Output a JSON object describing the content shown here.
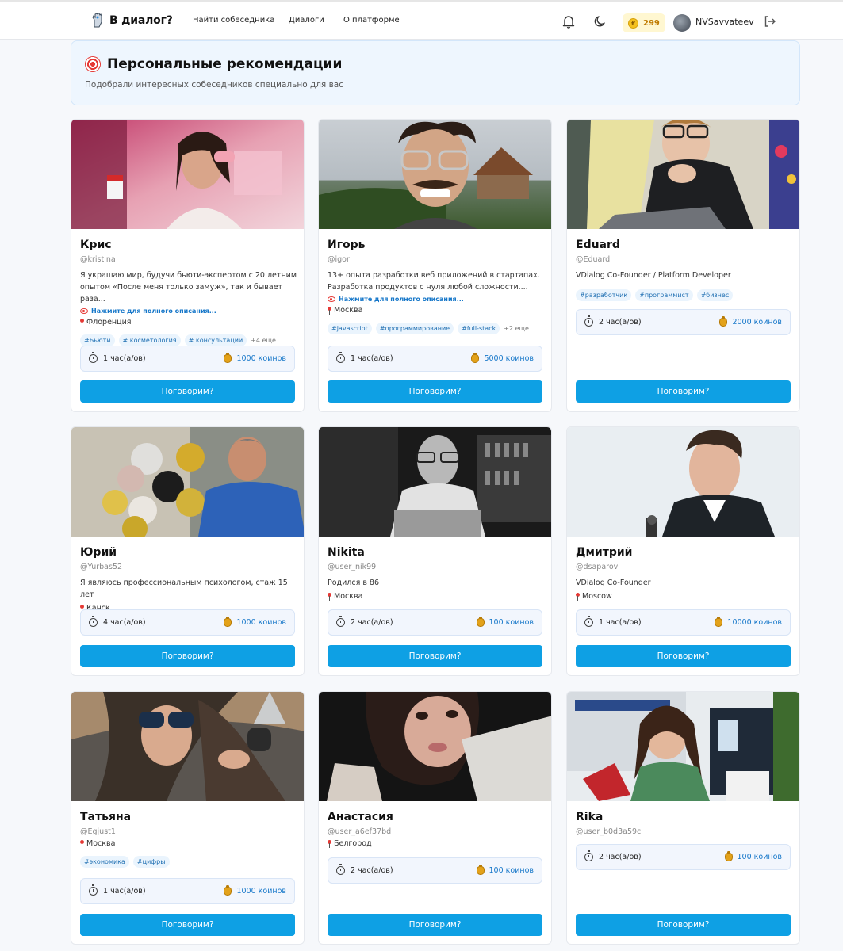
{
  "nav": {
    "logo_text": "В диалог?",
    "links": [
      "Найти собеседника",
      "Диалоги",
      "О платформе"
    ],
    "coins": "299",
    "username": "NVSavvateev"
  },
  "hero": {
    "title": "Персональные рекомендации",
    "subtitle": "Подобрали интересных собеседников специально для вас"
  },
  "cta_label": "Поговорим?",
  "more_label": "Нажмите для полного описания...",
  "cards": [
    {
      "name": "Крис",
      "handle": "@kristina",
      "bio": "Я украшаю мир, будучи бьюти-экспертом с 20 летним опытом «После меня только замуж», так и бывает раза...",
      "location": "Флоренция",
      "tags": [
        "#Бьюти",
        "# косметология",
        "# консультации"
      ],
      "tags_more": "+4 еще",
      "duration": "1 час(а/ов)",
      "price": "1000 коинов"
    },
    {
      "name": "Игорь",
      "handle": "@igor",
      "bio": "13+ опыта разработки веб приложений в стартапах. Разработка продуктов с нуля любой сложности....",
      "location": "Москва",
      "tags": [
        "#javascript",
        "#программирование",
        "#full-stack"
      ],
      "tags_more": "+2 еще",
      "duration": "1 час(а/ов)",
      "price": "5000 коинов"
    },
    {
      "name": "Eduard",
      "handle": "@Eduard",
      "bio": "VDialog Co-Founder / Platform Developer",
      "tags": [
        "#разработчик",
        "#программист",
        "#бизнес"
      ],
      "duration": "2 час(а/ов)",
      "price": "2000 коинов"
    },
    {
      "name": "Юрий",
      "handle": "@Yurbas52",
      "bio": "Я являюсь профессиональным психологом, стаж 15 лет",
      "location": "Канск",
      "duration": "4 час(а/ов)",
      "price": "1000 коинов"
    },
    {
      "name": "Nikita",
      "handle": "@user_nik99",
      "bio": "Родился в 86",
      "location": "Москва",
      "duration": "2 час(а/ов)",
      "price": "100 коинов"
    },
    {
      "name": "Дмитрий",
      "handle": "@dsaparov",
      "bio": "VDialog Co-Founder",
      "location": "Moscow",
      "duration": "1 час(а/ов)",
      "price": "10000 коинов"
    },
    {
      "name": "Татьяна",
      "handle": "@Egjust1",
      "location": "Москва",
      "tags": [
        "#экономика",
        "#цифры"
      ],
      "duration": "1 час(а/ов)",
      "price": "1000 коинов"
    },
    {
      "name": "Анастасия",
      "handle": "@user_a6ef37bd",
      "location": "Белгород",
      "duration": "2 час(а/ов)",
      "price": "100 коинов"
    },
    {
      "name": "Rika",
      "handle": "@user_b0d3a59c",
      "duration": "2 час(а/ов)",
      "price": "100 коинов"
    }
  ]
}
